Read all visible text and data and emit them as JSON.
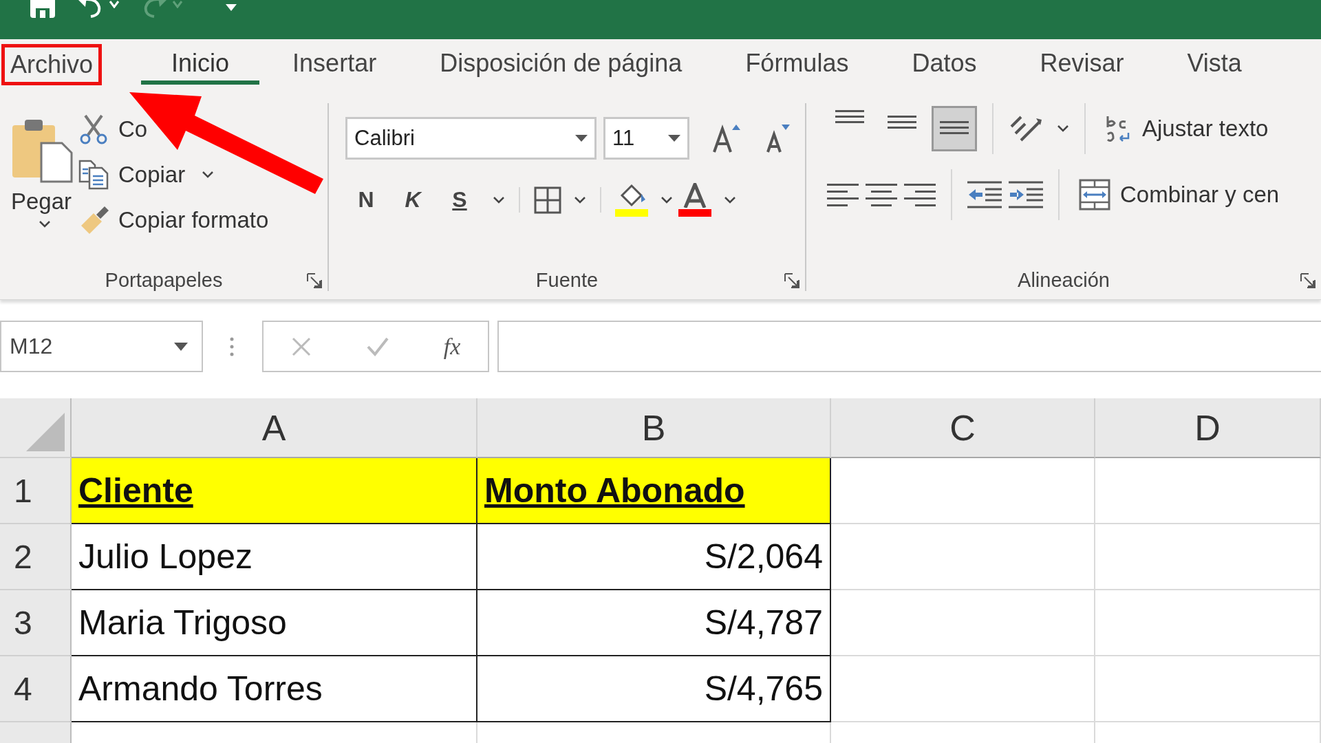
{
  "tabs": [
    {
      "label": "Archivo",
      "selected": false,
      "highlighted": true
    },
    {
      "label": "Inicio",
      "selected": true,
      "highlighted": false
    },
    {
      "label": "Insertar",
      "selected": false,
      "highlighted": false
    },
    {
      "label": "Disposición de página",
      "selected": false,
      "highlighted": false
    },
    {
      "label": "Fórmulas",
      "selected": false,
      "highlighted": false
    },
    {
      "label": "Datos",
      "selected": false,
      "highlighted": false
    },
    {
      "label": "Revisar",
      "selected": false,
      "highlighted": false
    },
    {
      "label": "Vista",
      "selected": false,
      "highlighted": false
    }
  ],
  "clipboard": {
    "paste": "Pegar",
    "cut": "Co",
    "copy": "Copiar",
    "format_painter": "Copiar formato",
    "label": "Portapapeles"
  },
  "font": {
    "name": "Calibri",
    "size": "11",
    "bold": "N",
    "italic": "K",
    "underline": "S",
    "color_buttons": [
      {
        "kind": "fill",
        "color": "#ffff00"
      },
      {
        "kind": "text",
        "color": "#ff0000"
      }
    ],
    "label": "Fuente"
  },
  "alignment": {
    "vertical": [
      {
        "selected": false
      },
      {
        "selected": false
      },
      {
        "selected": true
      }
    ],
    "wrap": "Ajustar texto",
    "merge": "Combinar y cen",
    "label": "Alineación"
  },
  "formula_bar": {
    "name_box": "M12",
    "function_label": "fx"
  },
  "sheet": {
    "columns": [
      "A",
      "B",
      "C",
      "D"
    ],
    "rows": [
      {
        "number": "1",
        "kind": "header",
        "cells": [
          "Cliente",
          "Monto Abonado"
        ]
      },
      {
        "number": "2",
        "kind": "data",
        "cells": [
          "Julio Lopez",
          "S/2,064"
        ]
      },
      {
        "number": "3",
        "kind": "data",
        "cells": [
          "Maria Trigoso",
          "S/4,787"
        ]
      },
      {
        "number": "4",
        "kind": "data",
        "cells": [
          "Armando Torres",
          "S/4,765"
        ]
      }
    ]
  }
}
